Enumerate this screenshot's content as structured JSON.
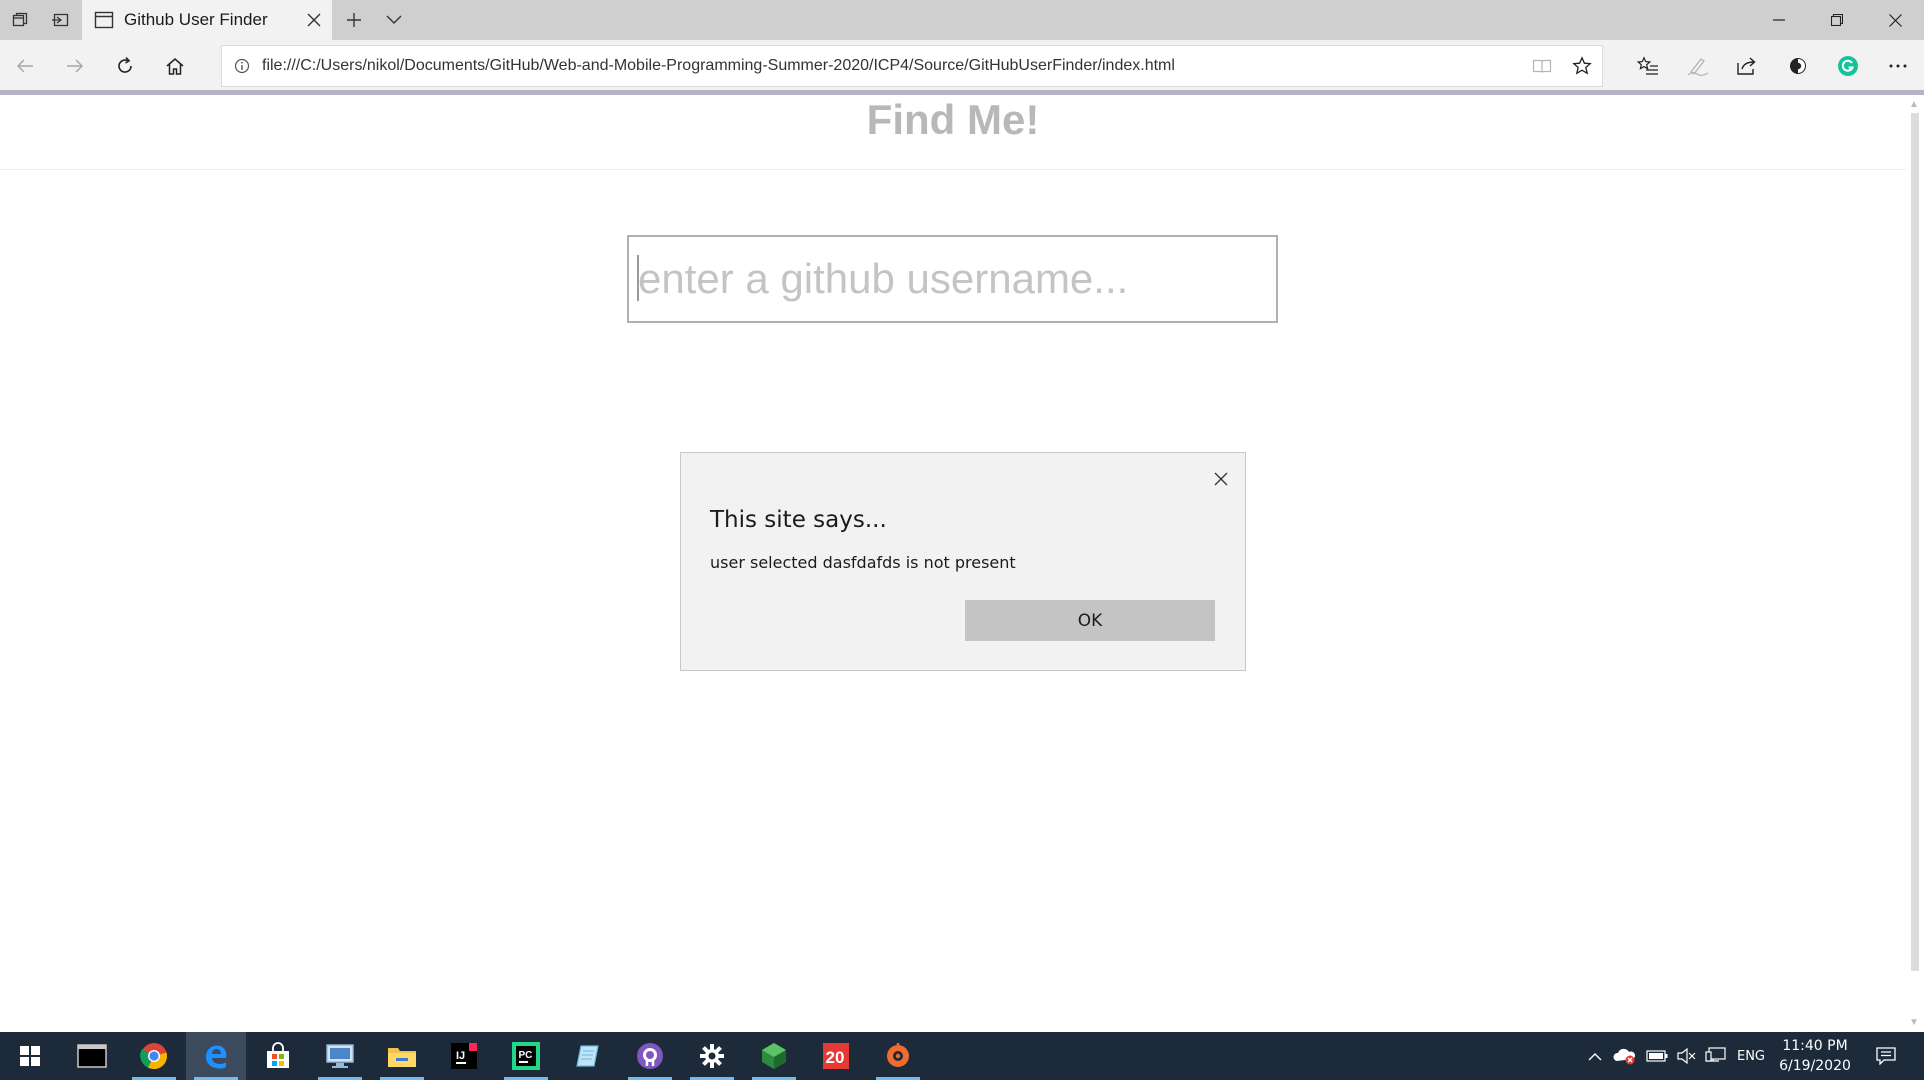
{
  "browser": {
    "tab": {
      "title": "Github User Finder"
    },
    "address": {
      "url": "file:///C:/Users/nikol/Documents/GitHub/Web-and-Mobile-Programming-Summer-2020/ICP4/Source/GitHubUserFinder/index.html"
    }
  },
  "page": {
    "title": "Find Me!",
    "search": {
      "placeholder": "enter a github username...",
      "value": ""
    }
  },
  "dialog": {
    "title": "This site says...",
    "message": "user selected dasfdafds is not present",
    "ok_label": "OK"
  },
  "taskbar": {
    "apps": [
      "windows-start",
      "terminal",
      "chrome",
      "edge",
      "microsoft-store",
      "remote-desktop",
      "file-explorer",
      "intellij",
      "pycharm",
      "notepad",
      "github-desktop",
      "settings",
      "cube-app",
      "calendar",
      "media-app"
    ],
    "calendar_badge": "20",
    "language": "ENG",
    "time": "11:40 PM",
    "date": "6/19/2020"
  },
  "colors": {
    "accent": "#0078d7",
    "taskbar": "#1c2a3a",
    "chrome_bg": "#f2f2f2"
  }
}
